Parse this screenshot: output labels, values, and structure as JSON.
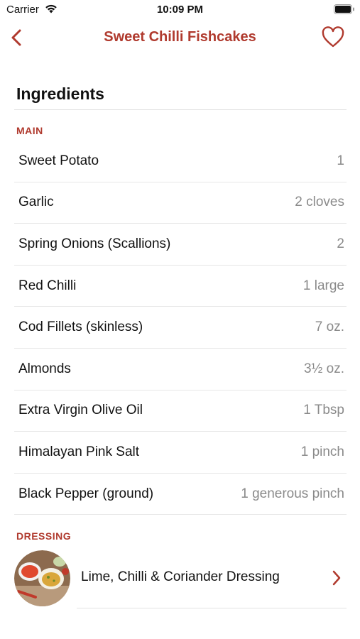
{
  "status_bar": {
    "carrier": "Carrier",
    "time": "10:09 PM"
  },
  "nav": {
    "title": "Sweet Chilli Fishcakes",
    "back_icon": "chevron-left-icon",
    "favorite_icon": "heart-outline-icon"
  },
  "section": {
    "heading": "Ingredients"
  },
  "groups": {
    "main_label": "MAIN",
    "dressing_label": "DRESSING"
  },
  "ingredients": [
    {
      "name": "Sweet Potato",
      "qty": "1"
    },
    {
      "name": "Garlic",
      "qty": "2 cloves"
    },
    {
      "name": "Spring Onions (Scallions)",
      "qty": "2"
    },
    {
      "name": "Red Chilli",
      "qty": "1 large"
    },
    {
      "name": "Cod Fillets (skinless)",
      "qty": "7 oz."
    },
    {
      "name": "Almonds",
      "qty": "3½ oz."
    },
    {
      "name": "Extra Virgin Olive Oil",
      "qty": "1 Tbsp"
    },
    {
      "name": "Himalayan Pink Salt",
      "qty": "1 pinch"
    },
    {
      "name": "Black Pepper (ground)",
      "qty": "1 generous pinch"
    }
  ],
  "dressing": {
    "name": "Lime, Chilli & Coriander Dressing",
    "chevron_icon": "chevron-right-icon"
  },
  "colors": {
    "accent": "#b03a2e",
    "secondary_text": "#8a8a8a",
    "divider": "#e6e6e6"
  }
}
